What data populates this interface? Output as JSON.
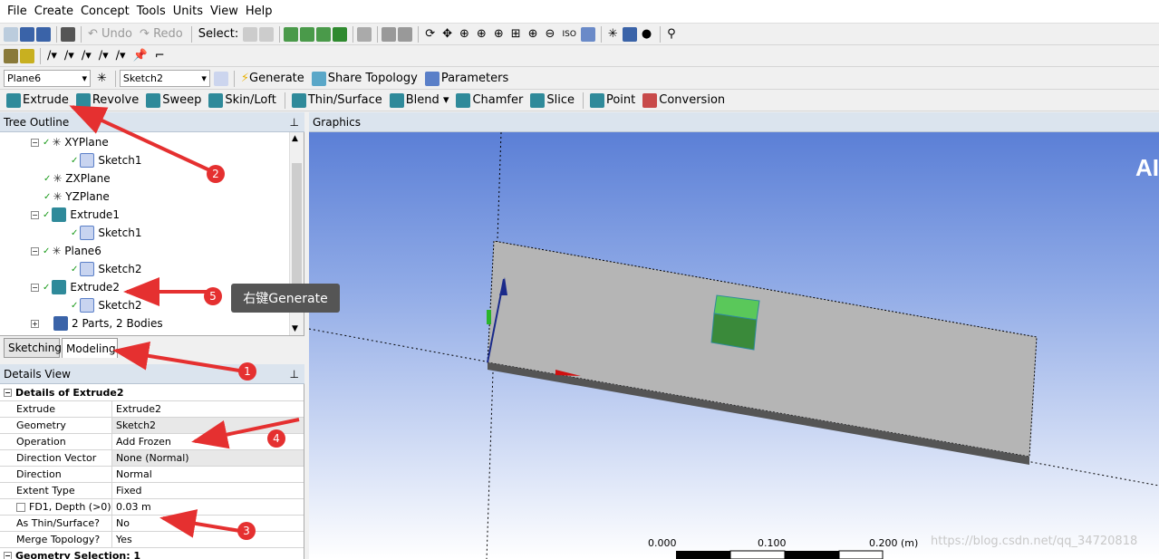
{
  "menu": [
    "File",
    "Create",
    "Concept",
    "Tools",
    "Units",
    "View",
    "Help"
  ],
  "toolbar1": {
    "undo": "Undo",
    "redo": "Redo",
    "select": "Select:"
  },
  "toolbar3": {
    "plane": "Plane6",
    "sketch": "Sketch2",
    "generate": "Generate",
    "share_topology": "Share Topology",
    "parameters": "Parameters"
  },
  "toolbar4": {
    "extrude": "Extrude",
    "revolve": "Revolve",
    "sweep": "Sweep",
    "skin_loft": "Skin/Loft",
    "thin_surface": "Thin/Surface",
    "blend": "Blend",
    "chamfer": "Chamfer",
    "slice": "Slice",
    "point": "Point",
    "conversion": "Conversion"
  },
  "tree": {
    "title": "Tree Outline",
    "items": [
      {
        "label": "XYPlane",
        "icon": "plane-icon",
        "level": 1,
        "expander": "−"
      },
      {
        "label": "Sketch1",
        "icon": "sketch-icon",
        "level": 2
      },
      {
        "label": "ZXPlane",
        "icon": "plane-icon",
        "level": 1
      },
      {
        "label": "YZPlane",
        "icon": "plane-icon",
        "level": 1
      },
      {
        "label": "Extrude1",
        "icon": "extrude-icon",
        "level": 1,
        "expander": "−"
      },
      {
        "label": "Sketch1",
        "icon": "sketch-icon",
        "level": 2
      },
      {
        "label": "Plane6",
        "icon": "plane-icon",
        "level": 1,
        "expander": "−"
      },
      {
        "label": "Sketch2",
        "icon": "sketch-icon",
        "level": 2
      },
      {
        "label": "Extrude2",
        "icon": "extrude-icon",
        "level": 1,
        "expander": "−"
      },
      {
        "label": "Sketch2",
        "icon": "sketch-icon",
        "level": 2
      },
      {
        "label": "2 Parts, 2 Bodies",
        "icon": "parts-icon",
        "level": 1,
        "expander": "+"
      }
    ]
  },
  "tabs": {
    "sketching": "Sketching",
    "modeling": "Modeling"
  },
  "details": {
    "title": "Details View",
    "header": "Details of Extrude2",
    "rows": [
      {
        "key": "Extrude",
        "value": "Extrude2"
      },
      {
        "key": "Geometry",
        "value": "Sketch2"
      },
      {
        "key": "Operation",
        "value": "Add Frozen"
      },
      {
        "key": "Direction Vector",
        "value": "None (Normal)"
      },
      {
        "key": "Direction",
        "value": "Normal"
      },
      {
        "key": "Extent Type",
        "value": "Fixed"
      },
      {
        "key": "FD1, Depth (>0)",
        "value": "0.03 m"
      },
      {
        "key": "As Thin/Surface?",
        "value": "No"
      },
      {
        "key": "Merge Topology?",
        "value": "Yes"
      },
      {
        "key": "Geometry Selection: 1",
        "value": ""
      }
    ]
  },
  "graphics": {
    "title": "Graphics",
    "logo_partial": "AI",
    "scale": {
      "t0": "0.000",
      "t1": "0.100",
      "t2": "0.200 (m)"
    },
    "watermark": "https://blog.csdn.net/qq_34720818"
  },
  "annotations": {
    "n1": "1",
    "n2": "2",
    "n3": "3",
    "n4": "4",
    "n5": "5",
    "tooltip": "右键Generate"
  }
}
